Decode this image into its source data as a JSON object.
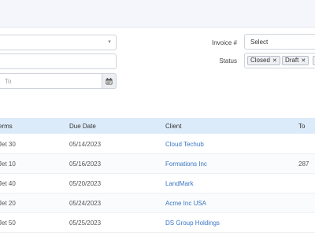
{
  "filters": {
    "date_to_placeholder": "To",
    "invoice_label": "Invoice #",
    "invoice_select_value": "Select",
    "status_label": "Status",
    "status_tags": [
      "Closed",
      "Draft",
      ""
    ]
  },
  "table": {
    "headers": [
      "erms",
      "Due Date",
      "Client",
      "To"
    ],
    "rows": [
      {
        "terms": "Jet 30",
        "due": "05/14/2023",
        "client": "Cloud Techub",
        "total": ""
      },
      {
        "terms": "Jet 10",
        "due": "05/16/2023",
        "client": "Formations Inc",
        "total": "287"
      },
      {
        "terms": "Jet 40",
        "due": "05/20/2023",
        "client": "LandMark",
        "total": ""
      },
      {
        "terms": "Jet 20",
        "due": "05/24/2023",
        "client": "Acme Inc USA",
        "total": ""
      },
      {
        "terms": "Jet 50",
        "due": "05/25/2023",
        "client": "DS Group Holdings",
        "total": ""
      }
    ]
  },
  "colors": {
    "accent": "#3a76c4",
    "header_bg": "#dcebfa",
    "topbar_bg": "#f4f6fc"
  },
  "icons": {
    "dropdown": "chevron-down-icon",
    "calendar": "calendar-icon",
    "remove_tag": "close-icon"
  }
}
